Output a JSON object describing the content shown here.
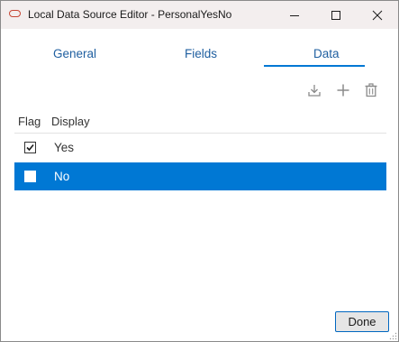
{
  "window": {
    "title": "Local Data Source Editor - PersonalYesNo",
    "icon": "oracle-logo-icon"
  },
  "titlebar_buttons": [
    "minimize-icon",
    "maximize-icon",
    "close-icon"
  ],
  "tabs": [
    {
      "label": "General",
      "selected": false
    },
    {
      "label": "Fields",
      "selected": false
    },
    {
      "label": "Data",
      "selected": true
    }
  ],
  "toolbar": {
    "icons": [
      "import-icon",
      "add-icon",
      "delete-icon"
    ]
  },
  "table": {
    "columns": [
      "Flag",
      "Display"
    ],
    "rows": [
      {
        "flag": true,
        "display": "Yes",
        "selected": false
      },
      {
        "flag": false,
        "display": "No",
        "selected": true
      }
    ]
  },
  "footer": {
    "done_label": "Done"
  },
  "colors": {
    "accent": "#0078d4",
    "tab_text": "#1f5fa0",
    "titlebar_bg": "#f3eeee",
    "logo": "#c74634"
  }
}
